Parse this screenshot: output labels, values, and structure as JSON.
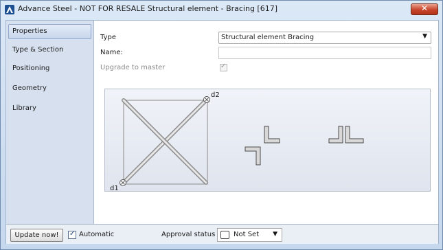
{
  "window": {
    "title": "Advance Steel - NOT FOR RESALE  Structural element - Bracing [617]",
    "close_glyph": "✕"
  },
  "sidebar": {
    "items": [
      {
        "label": "Properties",
        "active": true
      },
      {
        "label": "Type & Section",
        "active": false
      },
      {
        "label": "Positioning",
        "active": false
      },
      {
        "label": "Geometry",
        "active": false
      },
      {
        "label": "Library",
        "active": false
      }
    ]
  },
  "properties": {
    "type_label": "Type",
    "type_value": "Structural element Bracing",
    "name_label": "Name:",
    "name_value": "",
    "upgrade_label": "Upgrade to master",
    "upgrade_checked": true
  },
  "preview": {
    "label_d1": "d1",
    "label_d2": "d2"
  },
  "footer": {
    "update_button": "Update now!",
    "automatic_label": "Automatic",
    "automatic_checked": true,
    "approval_label": "Approval status",
    "approval_value": "Not Set"
  },
  "icons": {
    "app": "advance-steel-logo-icon",
    "close": "close-icon",
    "dropdown": "chevron-down-icon",
    "check": "checkmark-icon"
  },
  "colors": {
    "accent": "#1d4f91",
    "close_button": "#c8452c",
    "sidebar_bg": "#d6e0ef"
  }
}
